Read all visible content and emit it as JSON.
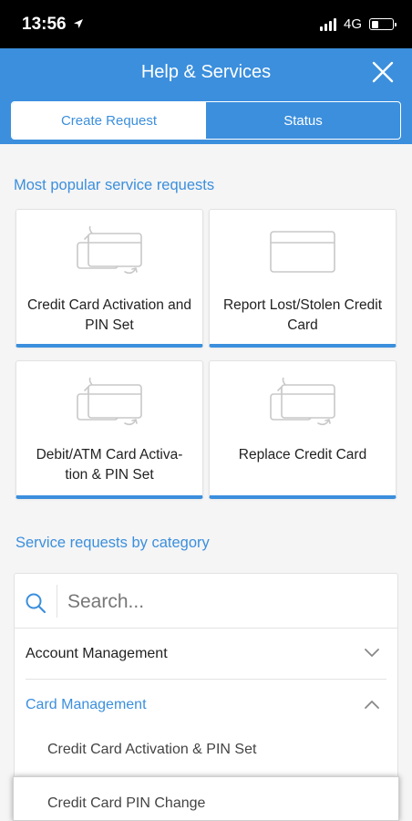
{
  "status_bar": {
    "time": "13:56",
    "network": "4G"
  },
  "header": {
    "title": "Help & Services"
  },
  "tabs": [
    {
      "label": "Create Request",
      "active": true
    },
    {
      "label": "Status",
      "active": false
    }
  ],
  "popular": {
    "title": "Most popular service requests",
    "cards": [
      {
        "line1": "Credit Card Activation and",
        "line2": "PIN Set",
        "icon": "card-activation-icon"
      },
      {
        "line1": "Report Lost/Stolen Credit",
        "line2": "Card",
        "icon": "card-icon"
      },
      {
        "line1": "Debit/ATM Card Activa-",
        "line2": "tion & PIN Set",
        "icon": "card-activation-icon"
      },
      {
        "line1": "Replace Credit Card",
        "line2": "",
        "icon": "card-replace-icon"
      }
    ]
  },
  "categories": {
    "title": "Service requests by category",
    "search_placeholder": "Search...",
    "items": [
      {
        "label": "Account Management",
        "expanded": false
      },
      {
        "label": "Card Management",
        "expanded": true
      }
    ],
    "sub_items": [
      "Credit Card Activation & PIN Set",
      "Credit Card PIN Change"
    ]
  },
  "colors": {
    "accent": "#3b8fdd",
    "header_bg": "#3b8fdd",
    "page_bg": "#f5f5f5"
  }
}
